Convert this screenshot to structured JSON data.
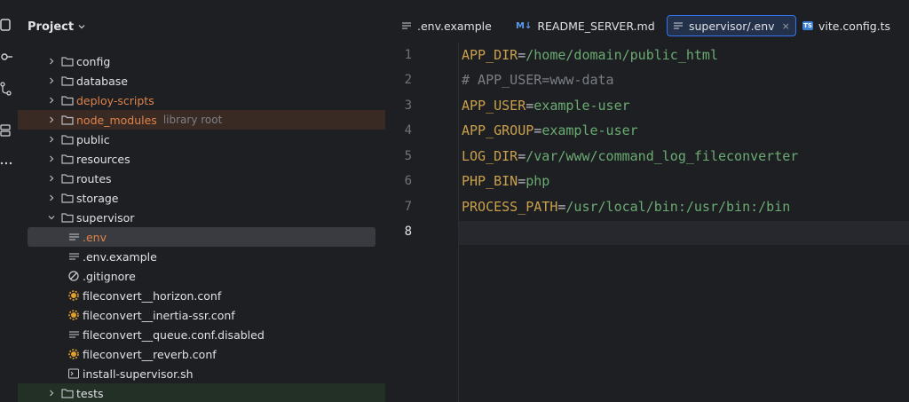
{
  "project_panel": {
    "title": "Project",
    "tree": [
      {
        "label": "config",
        "type": "folder"
      },
      {
        "label": "database",
        "type": "folder"
      },
      {
        "label": "deploy-scripts",
        "type": "folder",
        "color": "#e0834a"
      },
      {
        "label": "node_modules",
        "type": "folder",
        "color": "#e0834a",
        "suffix": "library root"
      },
      {
        "label": "public",
        "type": "folder"
      },
      {
        "label": "resources",
        "type": "folder"
      },
      {
        "label": "routes",
        "type": "folder"
      },
      {
        "label": "storage",
        "type": "folder"
      },
      {
        "label": "supervisor",
        "type": "folder",
        "expanded": true
      },
      {
        "label": ".env",
        "type": "file",
        "icon": "text-file-icon",
        "color": "#e0834a"
      },
      {
        "label": ".env.example",
        "type": "file",
        "icon": "text-file-icon"
      },
      {
        "label": ".gitignore",
        "type": "file",
        "icon": "ignore-file-icon"
      },
      {
        "label": "fileconvert__horizon.conf",
        "type": "file",
        "icon": "config-gear-icon"
      },
      {
        "label": "fileconvert__inertia-ssr.conf",
        "type": "file",
        "icon": "config-gear-icon"
      },
      {
        "label": "fileconvert__queue.conf.disabled",
        "type": "file",
        "icon": "text-file-icon"
      },
      {
        "label": "fileconvert__reverb.conf",
        "type": "file",
        "icon": "config-gear-icon"
      },
      {
        "label": "install-supervisor.sh",
        "type": "file",
        "icon": "shell-script-icon"
      },
      {
        "label": "tests",
        "type": "folder"
      }
    ]
  },
  "tabs": [
    {
      "label": ".env.example",
      "icon": "text-file-icon"
    },
    {
      "label": "README_SERVER.md",
      "icon": "markdown-icon",
      "badge": "M↓"
    },
    {
      "label": "supervisor/.env",
      "icon": "text-file-icon",
      "active": true,
      "close": "×"
    },
    {
      "label": "vite.config.ts",
      "icon": "typescript-icon",
      "badge": "TS"
    }
  ],
  "editor": {
    "lines": [
      {
        "n": "1",
        "key": "APP_DIR",
        "eq": "=",
        "val": "/home/domain/public_html"
      },
      {
        "n": "2",
        "comment": "# APP_USER=www-data"
      },
      {
        "n": "3",
        "key": "APP_USER",
        "eq": "=",
        "val": "example-user"
      },
      {
        "n": "4",
        "key": "APP_GROUP",
        "eq": "=",
        "val": "example-user"
      },
      {
        "n": "5",
        "key": "LOG_DIR",
        "eq": "=",
        "val": "/var/www/command_log_fileconverter"
      },
      {
        "n": "6",
        "key": "PHP_BIN",
        "eq": "=",
        "val": "php"
      },
      {
        "n": "7",
        "key": "PROCESS_PATH",
        "eq": "=",
        "val": "/usr/local/bin:/usr/bin:/bin"
      },
      {
        "n": "8"
      }
    ]
  },
  "colors": {
    "accent": "#3574f0",
    "key": "#c9a04e",
    "value": "#6aab73",
    "ignored": "#e0834a"
  }
}
